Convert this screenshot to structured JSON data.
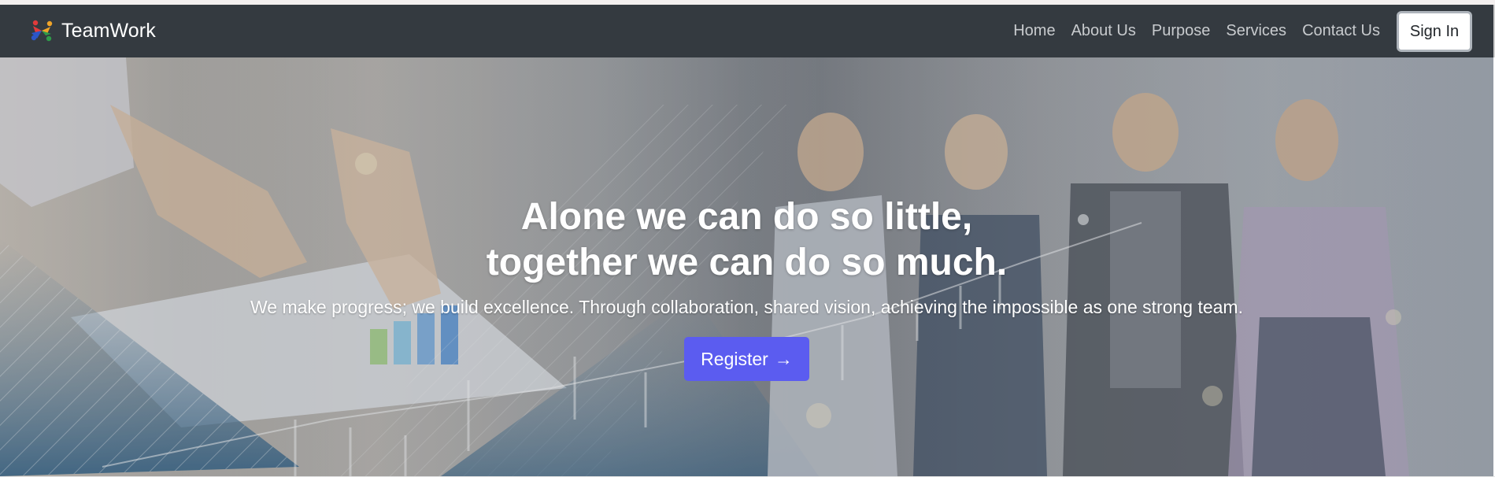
{
  "brand": {
    "name": "TeamWork",
    "logo_icon": "teamwork-people-logo-icon",
    "logo_colors": [
      "#e23b3b",
      "#f0a429",
      "#2f9c4a",
      "#2b56c8"
    ]
  },
  "nav": {
    "links": [
      {
        "label": "Home"
      },
      {
        "label": "About Us"
      },
      {
        "label": "Purpose"
      },
      {
        "label": "Services"
      },
      {
        "label": "Contact Us"
      }
    ],
    "signin_label": "Sign In"
  },
  "hero": {
    "title_line1": "Alone we can do so little,",
    "title_line2": "together we can do so much.",
    "subtitle": "We make progress; we build excellence. Through collaboration, shared vision, achieving the impossible as one strong team.",
    "cta_label": "Register",
    "cta_icon": "arrow-right-icon",
    "cta_arrow": "→",
    "background_image": "team-meeting-photo"
  },
  "colors": {
    "navbar_bg": "#343a40",
    "cta_bg": "#5b5cf0",
    "nav_link": "#c8cbce"
  }
}
